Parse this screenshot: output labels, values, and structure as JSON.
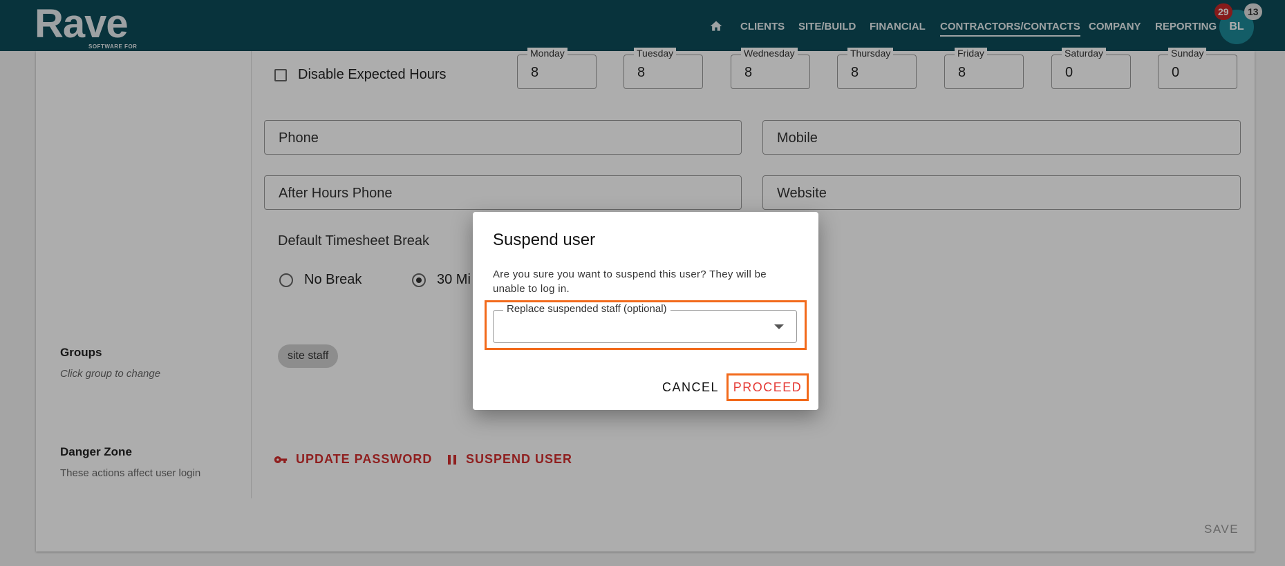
{
  "header": {
    "logo_text": "Rave",
    "logo_sub": "SOFTWARE FOR",
    "nav_items": [
      "CLIENTS",
      "SITE/BUILD",
      "FINANCIAL",
      "CONTRACTORS/CONTACTS",
      "COMPANY",
      "REPORTING"
    ],
    "active_nav": "CONTRACTORS/CONTACTS",
    "home_icon": "home-icon",
    "avatar_initials": "BL",
    "notification_count": "29",
    "message_count": "13"
  },
  "form": {
    "disable_expected_hours_label": "Disable Expected Hours",
    "days": [
      {
        "label": "Monday",
        "value": "8"
      },
      {
        "label": "Tuesday",
        "value": "8"
      },
      {
        "label": "Wednesday",
        "value": "8"
      },
      {
        "label": "Thursday",
        "value": "8"
      },
      {
        "label": "Friday",
        "value": "8"
      },
      {
        "label": "Saturday",
        "value": "0"
      },
      {
        "label": "Sunday",
        "value": "0"
      }
    ],
    "phone_placeholder": "Phone",
    "mobile_placeholder": "Mobile",
    "after_hours_phone_placeholder": "After Hours Phone",
    "website_placeholder": "Website",
    "timesheet_break_label": "Default Timesheet Break",
    "break_options": [
      "No Break",
      "30 Mi"
    ],
    "selected_break": "30 Mi"
  },
  "groups": {
    "title": "Groups",
    "subtitle": "Click group to change",
    "chips": [
      "site staff"
    ]
  },
  "danger_zone": {
    "title": "Danger Zone",
    "subtitle": "These actions affect user login",
    "update_password_label": "UPDATE PASSWORD",
    "suspend_user_label": "SUSPEND USER"
  },
  "save_label": "SAVE",
  "dialog": {
    "title": "Suspend user",
    "message": "Are you sure you want to suspend this user? They will be unable to log in.",
    "select_label": "Replace suspended staff (optional)",
    "select_value": "",
    "cancel_label": "CANCEL",
    "proceed_label": "PROCEED"
  },
  "colors": {
    "header_bg": "#0d4c59",
    "danger": "#d32f2f",
    "highlight": "#f26a1b"
  }
}
